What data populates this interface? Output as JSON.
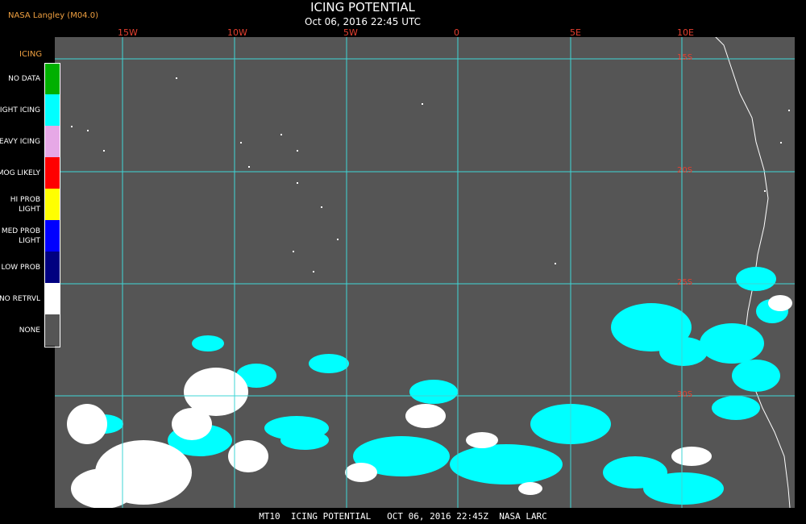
{
  "header": {
    "credit": "NASA Langley (M04.0)",
    "title": "ICING POTENTIAL",
    "subtitle": "Oct 06, 2016 22:45 UTC"
  },
  "map": {
    "lon_labels": [
      "15W",
      "10W",
      "5W",
      "0",
      "5E",
      "10E"
    ],
    "lat_labels": [
      "15S",
      "20S",
      "25S",
      "30S"
    ],
    "colors": {
      "background": "#555555",
      "grid": "#3fd6d6",
      "coast": "#ffffff",
      "night_icing": "#00ffff",
      "no_retrieval": "#ffffff"
    }
  },
  "legend": {
    "title": "ICING",
    "items": [
      {
        "label": "NO DATA",
        "color": "#00b000"
      },
      {
        "label": "NIGHT ICING",
        "color": "#00ffff"
      },
      {
        "label": "HEAVY ICING",
        "color": "#e6a8e6"
      },
      {
        "label": "MOG LIKELY",
        "color": "#ff0000"
      },
      {
        "label": "HI PROB LIGHT",
        "color": "#ffff00"
      },
      {
        "label": "MED PROB LIGHT",
        "color": "#0000ff"
      },
      {
        "label": "LOW PROB",
        "color": "#000080"
      },
      {
        "label": "NO RETRVL",
        "color": "#ffffff"
      },
      {
        "label": "NONE",
        "color": "#555555"
      }
    ]
  },
  "footer": {
    "text": "MT10  ICING POTENTIAL   OCT 06, 2016 22:45Z  NASA LARC"
  }
}
